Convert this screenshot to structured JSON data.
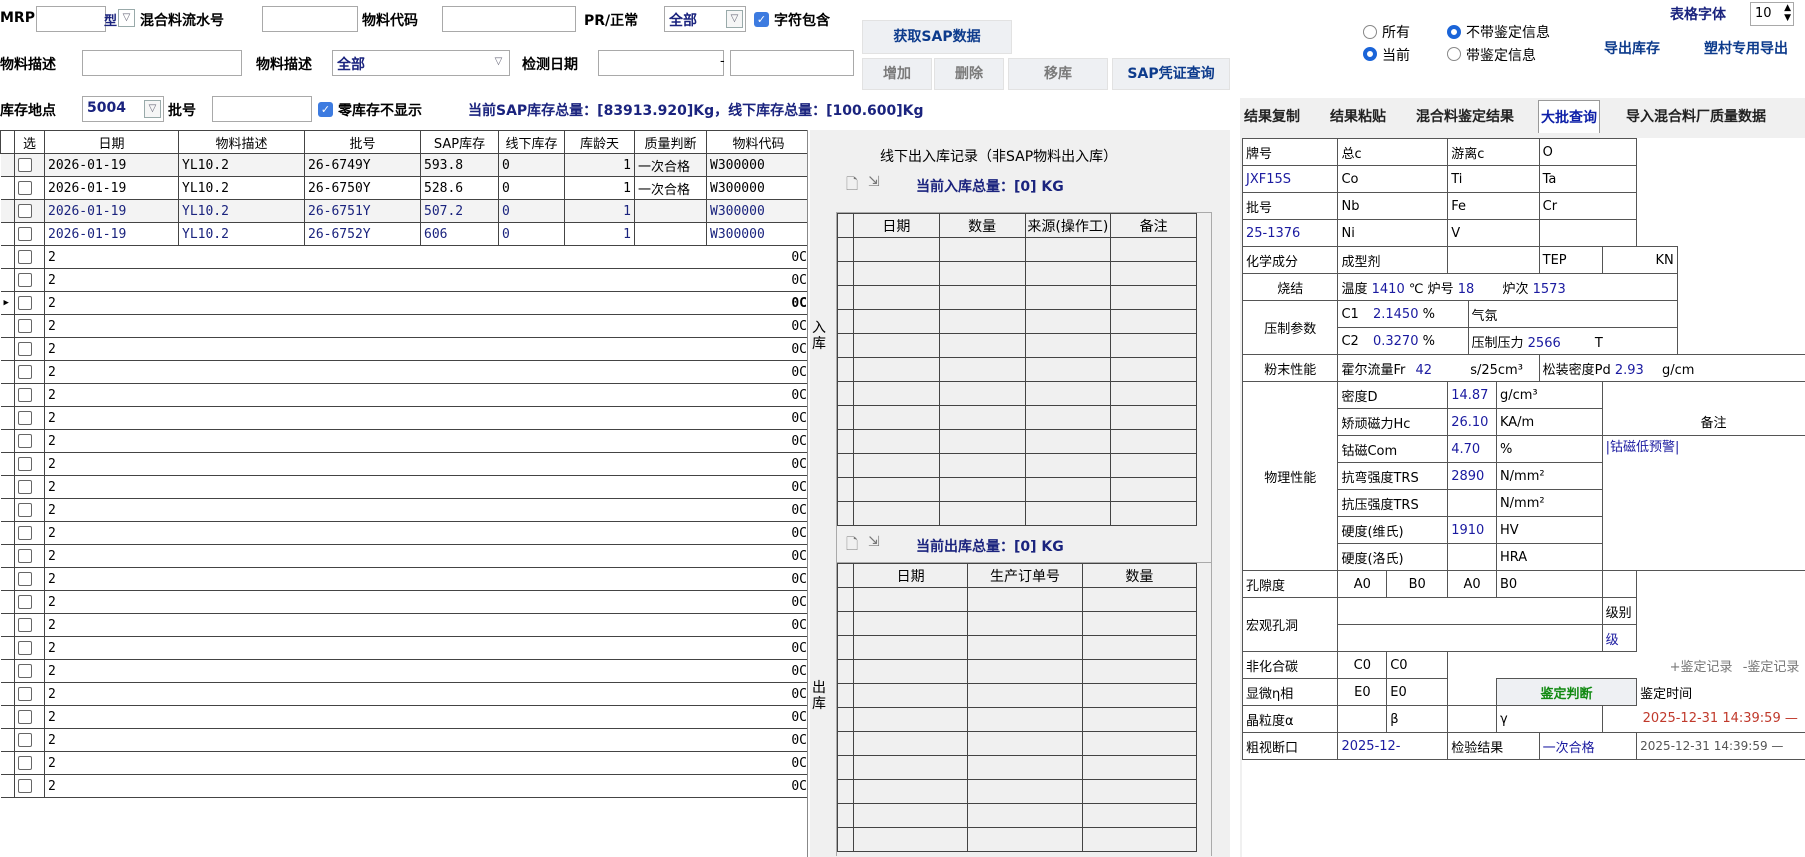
{
  "filters": {
    "mrp_label": "MRP",
    "mrp_value": "",
    "mrp_select": "型",
    "mix_lot_label": "混合料流水号",
    "mix_lot_value": "",
    "material_code_label": "物料代码",
    "material_code_value": "",
    "pr_label": "PR/正常",
    "pr_value": "全部",
    "char_include_label": "字符包含",
    "material_desc_label": "物料描述",
    "material_desc_value": "",
    "material_desc2_label": "物料描述",
    "material_desc2_value": "全部",
    "test_date_label": "检测日期",
    "test_date_from": "",
    "test_date_sep": "-",
    "test_date_to": "",
    "storage_label": "库存地点",
    "storage_value": "5004",
    "batch_label": "批号",
    "batch_value": "",
    "zero_stock_label": "零库存不显示",
    "stock_summary": "当前SAP库存总量：[83913.920]Kg，线下库存总量：[100.600]Kg"
  },
  "buttons": {
    "get_sap": "获取SAP数据",
    "add": "增加",
    "delete": "删除",
    "move": "移库",
    "sap_voucher": "SAP凭证查询",
    "export_stock": "导出库存",
    "export_special": "塑村专用导出",
    "font_label": "表格字体",
    "font_size": "10"
  },
  "radios": {
    "all": "所有",
    "current": "当前",
    "no_cert": "不带鉴定信息",
    "with_cert": "带鉴定信息"
  },
  "tabs": [
    "结果复制",
    "结果粘贴",
    "混合料鉴定结果",
    "大批查询",
    "导入混合料厂质量数据"
  ],
  "main_table": {
    "headers": [
      "选",
      "日期",
      "物料描述",
      "批号",
      "SAP库存",
      "线下库存",
      "库龄天",
      "质量判断",
      "物料代码"
    ],
    "rows": [
      [
        "2026-01-19",
        "YL10.2",
        "26-6749Y",
        "593.8",
        "0",
        "1",
        "一次合格",
        "W300000"
      ],
      [
        "2026-01-19",
        "YL10.2",
        "26-6750Y",
        "528.6",
        "0",
        "1",
        "一次合格",
        "W300000"
      ],
      [
        "2026-01-19",
        "YL10.2",
        "26-6751Y",
        "507.2",
        "0",
        "1",
        "",
        "W300000"
      ],
      [
        "2026-01-19",
        "YL10.2",
        "26-6752Y",
        "606",
        "0",
        "1",
        "",
        "W300000"
      ]
    ],
    "trunc_first": "2",
    "trunc_last": "0C",
    "trunc_current": "0C"
  },
  "middle": {
    "title": "线下出入库记录（非SAP物料出入库）",
    "in_total": "当前入库总量：[0] KG",
    "in_headers": [
      "日期",
      "数量",
      "来源(操作工)",
      "备注"
    ],
    "in_side": "入库",
    "out_total": "当前出库总量：[0] KG",
    "out_headers": [
      "日期",
      "生产订单号",
      "数量"
    ],
    "out_side": "出库"
  },
  "props": {
    "brand_label": "牌号",
    "brand": "JXF15S",
    "batch_label": "批号",
    "batch": "25-1376",
    "total_c": "总c",
    "free_c": "游离c",
    "o": "O",
    "co": "Co",
    "ti": "Ti",
    "ta": "Ta",
    "nb": "Nb",
    "fe": "Fe",
    "cr": "Cr",
    "ni": "Ni",
    "v": "V",
    "chem_label": "化学成分",
    "forming_agent": "成型剂",
    "tep": "TEP",
    "kn": "KN",
    "sinter_label": "烧结",
    "temp_label": "温度",
    "temp": "1410",
    "temp_unit": "℃",
    "furnace_label": "炉号",
    "furnace": "18",
    "furnace_count_label": "炉次",
    "furnace_count": "1573",
    "press_label": "压制参数",
    "c1_label": "C1",
    "c1": "2.1450",
    "c2_label": "C2",
    "c2": "0.3270",
    "pct": "%",
    "atmosphere": "气氛",
    "press_pressure_label": "压制压力",
    "press_pressure": "2566",
    "press_unit": "T",
    "powder_label": "粉末性能",
    "hall_flow_label": "霍尔流量Fr",
    "hall_flow": "42",
    "hall_flow_unit": "s/25cm³",
    "loose_density_label": "松装密度Pd",
    "loose_density": "2.93",
    "loose_density_unit": "g/cm",
    "physical_label": "物理性能",
    "density_label": "密度D",
    "density": "14.87",
    "density_unit": "g/cm³",
    "hc_label": "矫顽磁力Hc",
    "hc": "26.10",
    "hc_unit": "KA/m",
    "com_label": "钴磁Com",
    "com": "4.70",
    "trs_label": "抗弯强度TRS",
    "trs": "2890",
    "trs_unit": "N/mm²",
    "tcs_label": "抗压强度TRS",
    "tcs_unit": "N/mm²",
    "hv_label": "硬度(维氏)",
    "hv": "1910",
    "hv_unit": "HV",
    "hra_label": "硬度(洛氏)",
    "hra_unit": "HRA",
    "remark_label": "备注",
    "remark": "|钴磁低预警|",
    "porosity_label": "孔隙度",
    "porosity_values": [
      "A0",
      "B0",
      "A0",
      "B0"
    ],
    "macro_label": "宏观孔洞",
    "level_label": "级别",
    "level_unit": "级",
    "noncomb_label": "非化合碳",
    "noncomb_values": [
      "C0",
      "C0"
    ],
    "micro_label": "显微η相",
    "micro_values": [
      "E0",
      "E0"
    ],
    "judge_button": "鉴定判断",
    "grain_label": "晶粒度α",
    "beta": "β",
    "gamma": "γ",
    "add_record": "+鉴定记录",
    "del_record": "-鉴定记录",
    "cert_time_label": "鉴定时间",
    "cert_time": "2025-12-31 14:39:59 —",
    "cert_time_select": "2025-12-31 14:39:59 —",
    "fracture_label": "粗视断口",
    "fracture_date": "2025-12-",
    "test_result_label": "检验结果",
    "test_result": "一次合格"
  }
}
